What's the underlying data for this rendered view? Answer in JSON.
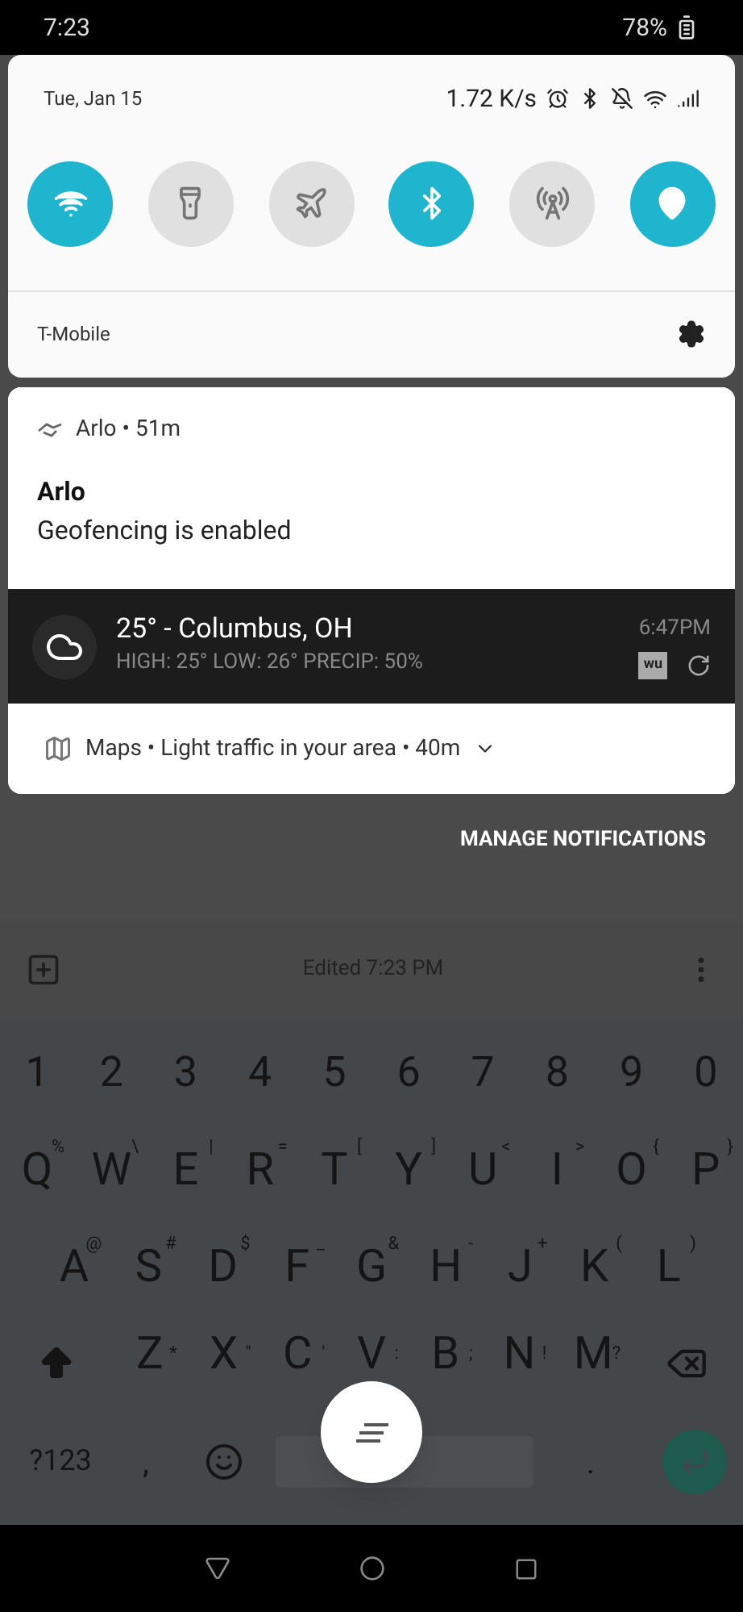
{
  "status_bar": {
    "time": "7:23",
    "battery": "78%"
  },
  "quick_settings": {
    "date": "Tue, Jan 15",
    "speed": "1.72 K/s",
    "carrier": "T-Mobile",
    "toggles": [
      {
        "kind": "wifi",
        "on": true
      },
      {
        "kind": "flashlight",
        "on": false
      },
      {
        "kind": "airplane",
        "on": false
      },
      {
        "kind": "bluetooth",
        "on": true
      },
      {
        "kind": "hotspot",
        "on": false
      },
      {
        "kind": "location",
        "on": true
      }
    ]
  },
  "notifications": [
    {
      "kind": "app",
      "app": "Arlo",
      "separator": "•",
      "time": "51m",
      "title": "Arlo",
      "text": "Geofencing is enabled"
    },
    {
      "kind": "weather",
      "title": "25° - Columbus, OH",
      "details": "HIGH: 25° LOW: 26° PRECIP: 50%",
      "time": "6:47PM",
      "badge": "wu"
    },
    {
      "kind": "summary",
      "app": "Maps",
      "separator_1": "•",
      "text": "Light traffic in your area",
      "separator_2": "•",
      "time": "40m"
    }
  ],
  "manage_button": "MANAGE NOTIFICATIONS",
  "note_toolbar": {
    "status": "Edited 7:23 PM"
  },
  "keyboard": {
    "numbers": [
      "1",
      "2",
      "3",
      "4",
      "5",
      "6",
      "7",
      "8",
      "9",
      "0"
    ],
    "rows": [
      [
        {
          "key": "Q",
          "hint": "%"
        },
        {
          "key": "W",
          "hint": "\\"
        },
        {
          "key": "E",
          "hint": "|"
        },
        {
          "key": "R",
          "hint": "="
        },
        {
          "key": "T",
          "hint": "["
        },
        {
          "key": "Y",
          "hint": "]"
        },
        {
          "key": "U",
          "hint": "<"
        },
        {
          "key": "I",
          "hint": ">"
        },
        {
          "key": "O",
          "hint": "{"
        },
        {
          "key": "P",
          "hint": "}"
        }
      ],
      [
        {
          "key": "A",
          "hint": "@"
        },
        {
          "key": "S",
          "hint": "#"
        },
        {
          "key": "D",
          "hint": "$"
        },
        {
          "key": "F",
          "hint": "_"
        },
        {
          "key": "G",
          "hint": "&"
        },
        {
          "key": "H",
          "hint": "-"
        },
        {
          "key": "J",
          "hint": "+"
        },
        {
          "key": "K",
          "hint": "("
        },
        {
          "key": "L",
          "hint": ")"
        }
      ],
      [
        {
          "key": "Z",
          "hint": "*"
        },
        {
          "key": "X",
          "hint": "\""
        },
        {
          "key": "C",
          "hint": "'"
        },
        {
          "key": "V",
          "hint": ":"
        },
        {
          "key": "B",
          "hint": ";"
        },
        {
          "key": "N",
          "hint": "!"
        },
        {
          "key": "M",
          "hint": "?"
        }
      ]
    ],
    "symbols_key": "?123",
    "comma": ",",
    "period": "."
  }
}
